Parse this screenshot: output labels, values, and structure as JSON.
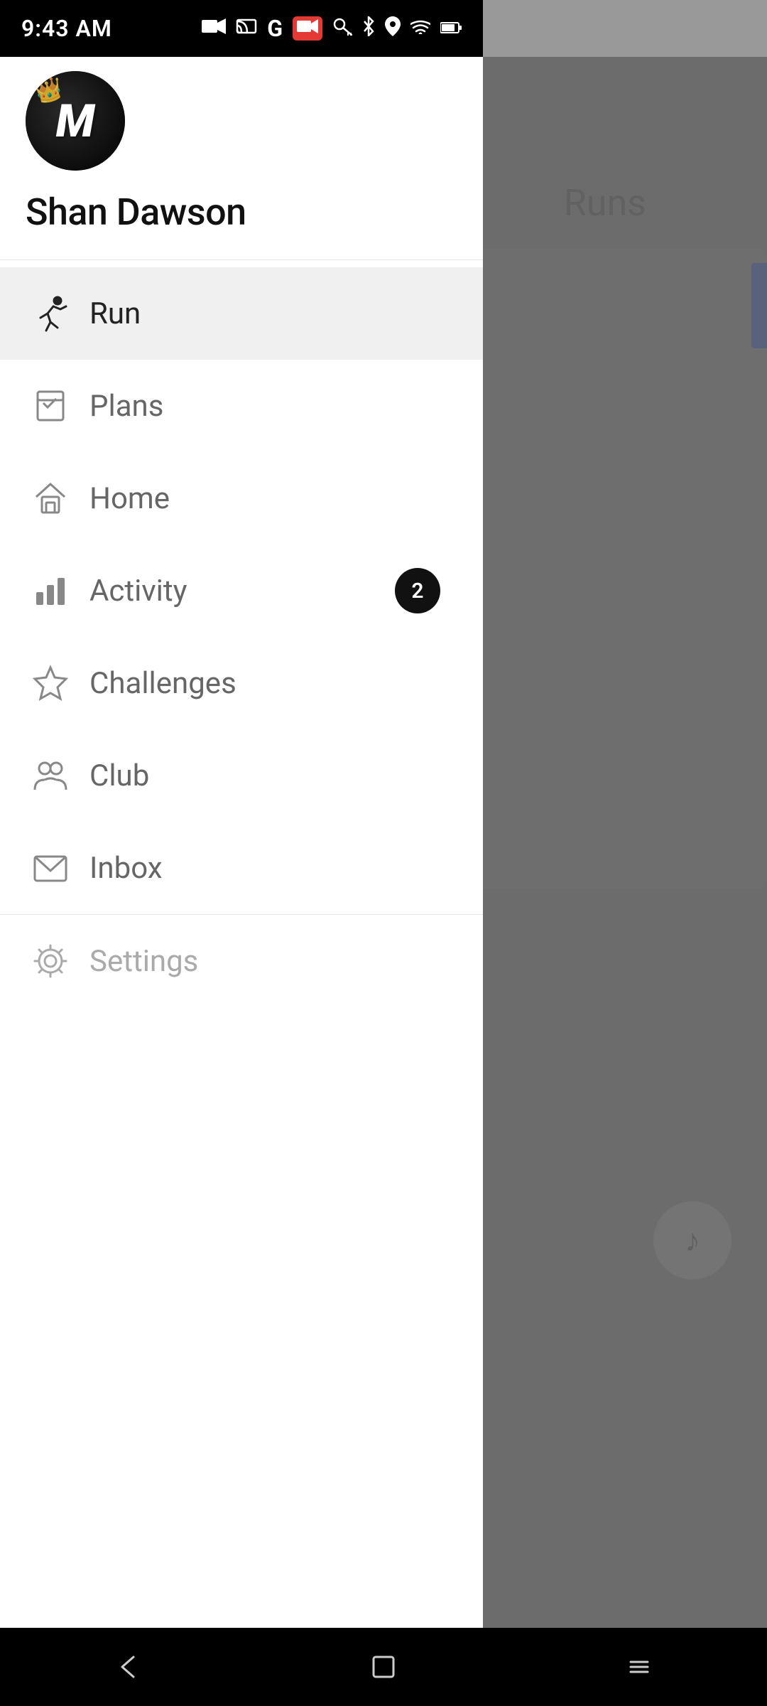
{
  "statusBar": {
    "time": "9:43 AM",
    "icons": [
      "camera-icon",
      "cast-icon",
      "google-icon",
      "record-icon",
      "key-icon",
      "bluetooth-icon",
      "location-icon",
      "wifi-icon",
      "battery-icon"
    ]
  },
  "profile": {
    "userName": "Shan Dawson",
    "avatarLetter": "M",
    "avatarCrown": "👑"
  },
  "nav": {
    "items": [
      {
        "id": "run",
        "label": "Run",
        "active": true,
        "badge": null
      },
      {
        "id": "plans",
        "label": "Plans",
        "active": false,
        "badge": null
      },
      {
        "id": "home",
        "label": "Home",
        "active": false,
        "badge": null
      },
      {
        "id": "activity",
        "label": "Activity",
        "active": false,
        "badge": 2
      },
      {
        "id": "challenges",
        "label": "Challenges",
        "active": false,
        "badge": null
      },
      {
        "id": "club",
        "label": "Club",
        "active": false,
        "badge": null
      },
      {
        "id": "inbox",
        "label": "Inbox",
        "active": false,
        "badge": null
      }
    ],
    "settingsLabel": "Settings"
  },
  "background": {
    "runsLabel": "Runs"
  },
  "bottomNav": {
    "back": "‹",
    "home": "□",
    "menu": "≡"
  }
}
